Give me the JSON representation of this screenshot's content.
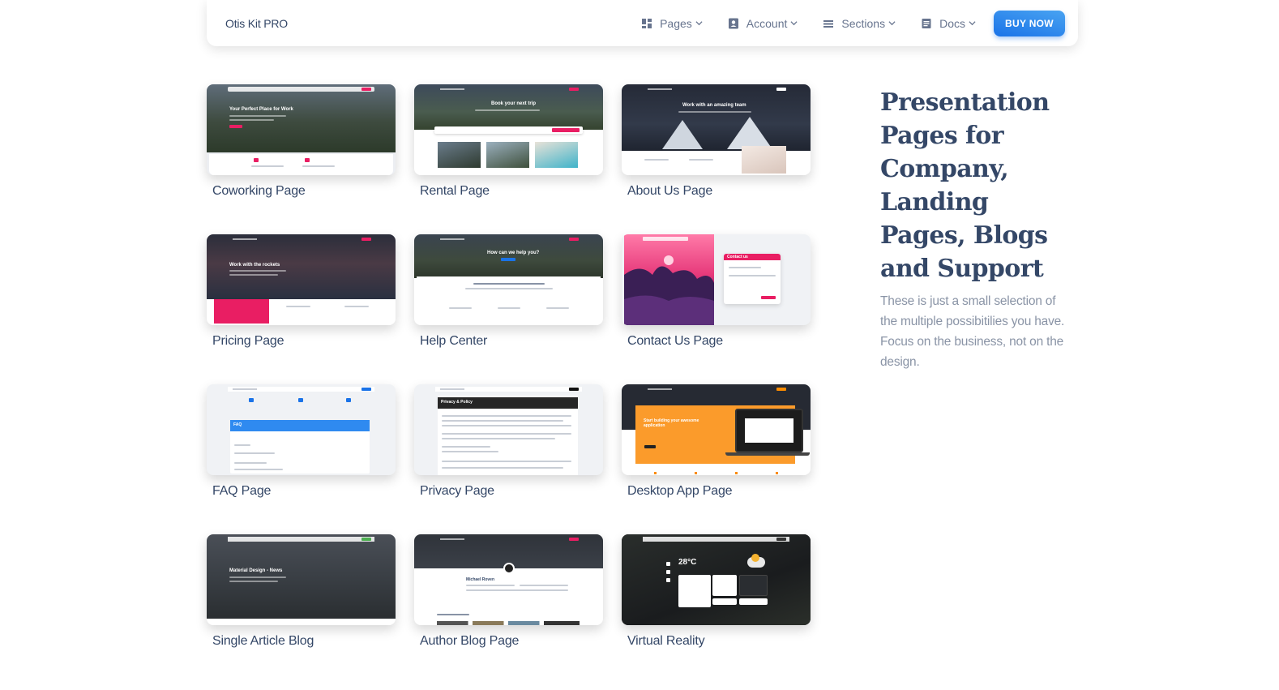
{
  "navbar": {
    "brand": "Otis Kit PRO",
    "items": [
      {
        "label": "Pages",
        "icon": "dashboard-icon"
      },
      {
        "label": "Account",
        "icon": "contact-card-icon"
      },
      {
        "label": "Sections",
        "icon": "list-icon"
      },
      {
        "label": "Docs",
        "icon": "article-icon"
      }
    ],
    "cta": "BUY NOW"
  },
  "pages": [
    {
      "label": "Coworking Page",
      "mini_title": "Your Perfect Place for Work"
    },
    {
      "label": "Rental Page",
      "mini_title": "Book your next trip"
    },
    {
      "label": "About Us Page",
      "mini_title": "Work with an amazing team"
    },
    {
      "label": "Pricing Page",
      "mini_title": "Work with the rockets"
    },
    {
      "label": "Help Center",
      "mini_title": "How can we help you?"
    },
    {
      "label": "Contact Us Page",
      "mini_title": "Contact us"
    },
    {
      "label": "FAQ Page",
      "mini_title": "FAQ"
    },
    {
      "label": "Privacy Page",
      "mini_title": "Privacy & Policy"
    },
    {
      "label": "Desktop App Page",
      "mini_title": "Start building your awesome application"
    },
    {
      "label": "Single Article Blog",
      "mini_title": "Material Design - News"
    },
    {
      "label": "Author Blog Page",
      "mini_title": "Michael Roven"
    },
    {
      "label": "Virtual Reality",
      "mini_title": "28°C"
    }
  ],
  "side": {
    "title": "Presentation Pages for Company, Landing Pages, Blogs and Support",
    "text": "These is just a small selection of the multiple possibitilies you have. Focus on the business, not on the design."
  },
  "colors": {
    "primary": "#1a73e8",
    "text": "#344767",
    "muted": "#8a94a6",
    "pink": "#e91e63",
    "orange": "#fb8c00"
  }
}
